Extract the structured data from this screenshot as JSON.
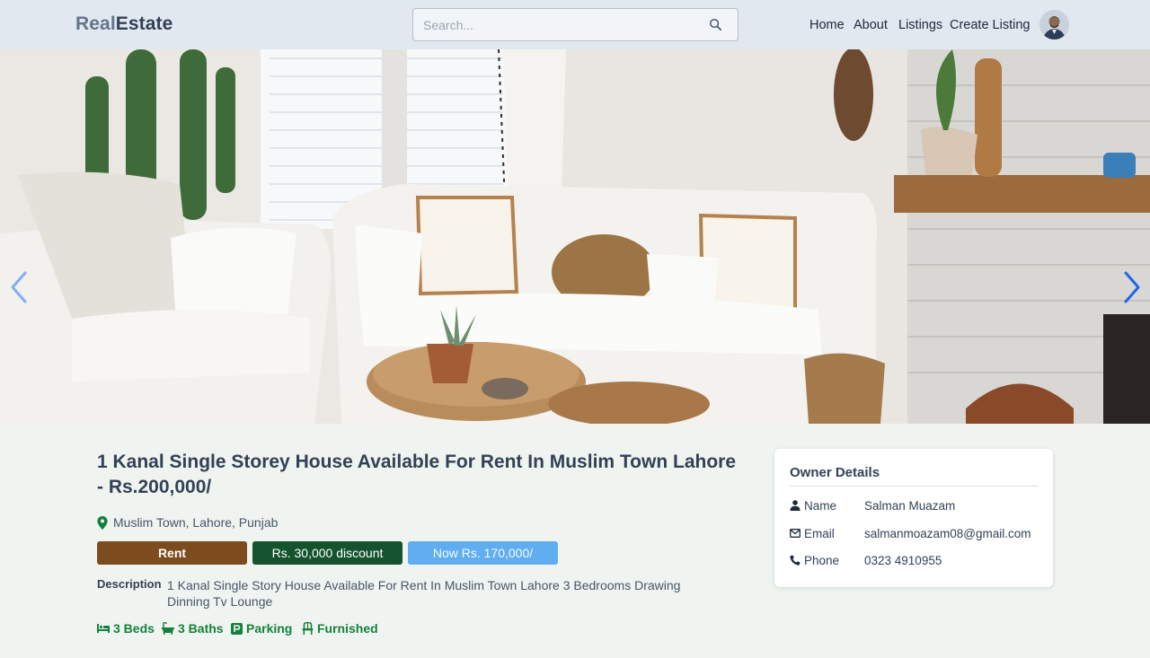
{
  "header": {
    "logo_part1": "Real",
    "logo_part2": "Estate",
    "search_placeholder": "Search...",
    "nav": [
      "Home",
      "About",
      "Listings",
      "Create Listing"
    ]
  },
  "hero": {
    "image_description": "living room with white sofas, cushions, round wooden tables, plants and white brick fireplace",
    "prev_icon": "chevron-left-icon",
    "next_icon": "chevron-right-icon"
  },
  "listing": {
    "title": "1 Kanal Single Storey House Available For Rent In Muslim Town Lahore - Rs.200,000/",
    "location": "Muslim Town, Lahore, Punjab",
    "type_badge": "Rent",
    "discount_badge": "Rs. 30,000 discount",
    "price_badge": "Now Rs. 170,000/",
    "description_label": "Description",
    "description": "1 Kanal Single Story House Available For Rent In Muslim Town Lahore 3 Bedrooms Drawing Dinning Tv Lounge",
    "features": [
      {
        "icon": "bed-icon",
        "label": "3 Beds"
      },
      {
        "icon": "bath-icon",
        "label": "3 Baths"
      },
      {
        "icon": "parking-icon",
        "label": "Parking"
      },
      {
        "icon": "chair-icon",
        "label": "Furnished"
      }
    ]
  },
  "owner": {
    "heading": "Owner Details",
    "rows": [
      {
        "icon": "user-icon",
        "label": "Name",
        "value": "Salman Muazam"
      },
      {
        "icon": "mail-icon",
        "label": "Email",
        "value": "salmanmoazam08@gmail.com"
      },
      {
        "icon": "phone-icon",
        "label": "Phone",
        "value": "0323 4910955"
      }
    ]
  },
  "colors": {
    "header_bg": "#e2e8f0",
    "page_bg": "#f0f4f1",
    "rent_badge": "#7c4b1e",
    "discount_badge": "#14532d",
    "price_badge": "#60aef0",
    "feature_text": "#15803d"
  }
}
